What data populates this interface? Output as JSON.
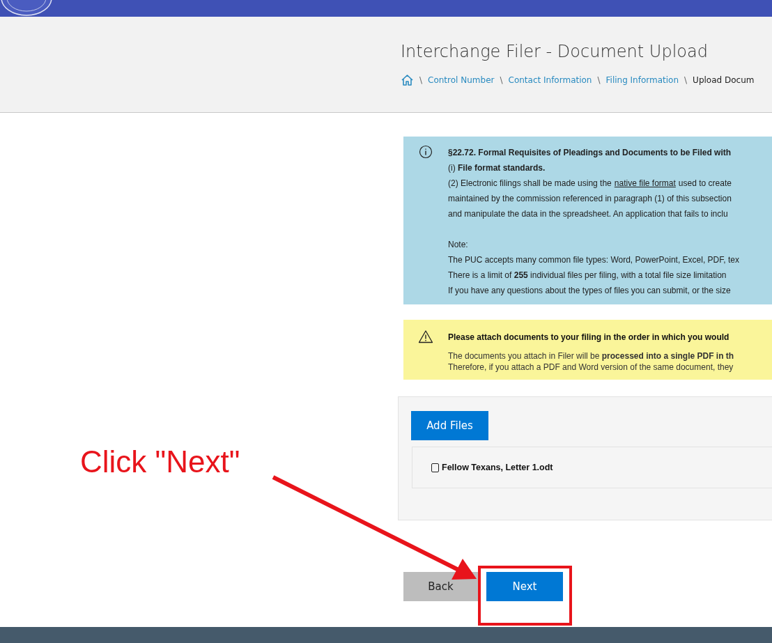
{
  "header": {
    "title": "Interchange Filer - Document Upload",
    "breadcrumb": [
      {
        "kind": "home"
      },
      {
        "kind": "link",
        "separator": "\\",
        "label": "Control Number"
      },
      {
        "kind": "link",
        "separator": "\\",
        "label": "Contact Information"
      },
      {
        "kind": "link",
        "separator": "\\",
        "label": "Filing Information"
      },
      {
        "kind": "current",
        "separator": "\\",
        "label": "Upload Docum"
      }
    ]
  },
  "info_box": {
    "lines": [
      {
        "kind": "bold",
        "text": "§22.72. Formal Requisites of Pleadings and Documents to be Filed with"
      },
      {
        "kind": "plain",
        "text": "(i) **File format standards.**"
      },
      {
        "kind": "link_line",
        "before": "(2) Electronic filings shall be made using the",
        "link": "native file format",
        "after": "used to create"
      },
      {
        "kind": "plain",
        "text": "maintained by the commission referenced in paragraph (1) of this subsection"
      },
      {
        "kind": "plain",
        "text": "and manipulate the data in the spreadsheet. An application that fails to inclu"
      },
      {
        "kind": "gap"
      },
      {
        "kind": "plain",
        "text": "Note:"
      },
      {
        "kind": "plain",
        "text": "The PUC accepts many common file types: Word, PowerPoint, Excel, PDF, tex"
      },
      {
        "kind": "plain",
        "text": "There is a limit of **255** individual files per filing, with a total file size limitation"
      },
      {
        "kind": "plain",
        "text": "If you have any questions about the types of files you can submit, or the size"
      }
    ]
  },
  "warning_box": {
    "heading": "Please attach documents to your filing in the order in which you would",
    "lines": [
      "The documents you attach in Filer will be **processed into a single PDF in th**",
      "Therefore, if you attach a PDF and Word version of the same document, they"
    ]
  },
  "upload": {
    "add_button": "Add Files",
    "files": [
      {
        "name": "Fellow Texans, Letter 1.odt",
        "checked": false
      }
    ]
  },
  "buttons": {
    "back": "Back",
    "next": "Next"
  },
  "annotation": {
    "text": "Click \"Next\""
  }
}
